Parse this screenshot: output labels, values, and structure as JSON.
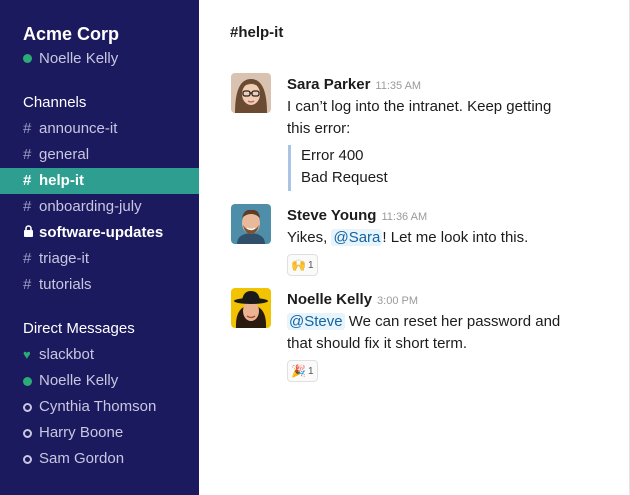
{
  "workspace": {
    "name": "Acme Corp",
    "user": "Noelle Kelly"
  },
  "channels": {
    "title": "Channels",
    "items": [
      {
        "label": "announce-it"
      },
      {
        "label": "general"
      },
      {
        "label": "help-it"
      },
      {
        "label": "onboarding-july"
      },
      {
        "label": "software-updates"
      },
      {
        "label": "triage-it"
      },
      {
        "label": "tutorials"
      }
    ]
  },
  "dms": {
    "title": "Direct Messages",
    "items": [
      {
        "label": "slackbot"
      },
      {
        "label": "Noelle Kelly"
      },
      {
        "label": "Cynthia Thomson"
      },
      {
        "label": "Harry Boone"
      },
      {
        "label": "Sam Gordon"
      }
    ]
  },
  "main": {
    "channel_title": "#help-it",
    "messages": [
      {
        "author": "Sara Parker",
        "time": "11:35 AM",
        "line1": "I can’t log into the intranet. Keep getting",
        "line2": "this error:",
        "quote1": "Error 400",
        "quote2": "Bad Request"
      },
      {
        "author": "Steve Young",
        "time": "11:36 AM",
        "pre": "Yikes, ",
        "mention": "@Sara",
        "post": "! Let me look into this.",
        "reaction_emoji": "🙌",
        "reaction_count": "1"
      },
      {
        "author": "Noelle Kelly",
        "time": "3:00 PM",
        "mention": "@Steve",
        "post": " We can reset her password and",
        "line2": "that should fix it short term.",
        "reaction_emoji": "🎉",
        "reaction_count": "1"
      }
    ]
  },
  "colors": {
    "sidebar": "#1c1a5e",
    "active": "#2d9e8f",
    "online": "#2bac76",
    "mention": "#1264a3"
  }
}
